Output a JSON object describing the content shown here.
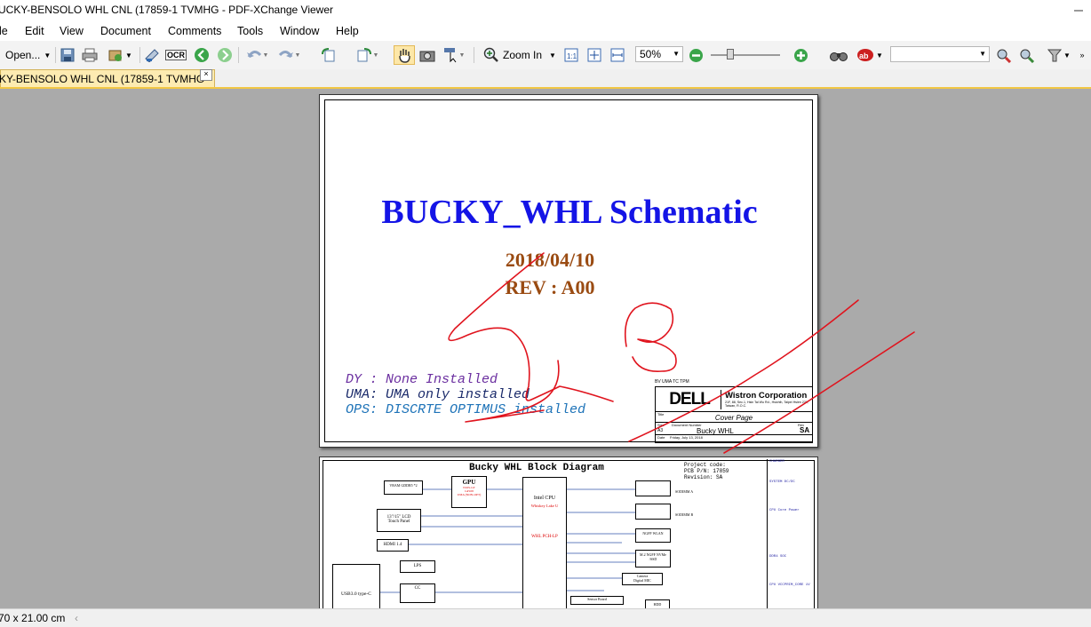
{
  "window": {
    "title": "UCKY-BENSOLO WHL CNL (17859-1 TVMHG - PDF-XChange Viewer"
  },
  "menu": [
    "le",
    "Edit",
    "View",
    "Document",
    "Comments",
    "Tools",
    "Window",
    "Help"
  ],
  "toolbar": {
    "open_label": "Open...",
    "ocr_label": "OCR",
    "zoom_in_label": "Zoom In",
    "zoom_value": "50%",
    "search_value": ""
  },
  "tab": {
    "label": "KY-BENSOLO WHL CNL (17859-1 TVMHG",
    "close": "×"
  },
  "cover_page": {
    "title": "BUCKY_WHL Schematic",
    "date": "2018/04/10",
    "rev": "REV : A00",
    "legend": [
      {
        "text": "DY : None Installed",
        "color": "#6b2fa0"
      },
      {
        "text": "UMA: UMA only installed",
        "color": "#1a2a6a"
      },
      {
        "text": "OPS: DISCRTE OPTIMUS installed",
        "color": "#1e73b8"
      }
    ],
    "titleblock": {
      "header_note": "BV UMA TC TPM",
      "logo": "DELL",
      "company": "Wistron Corporation",
      "address": "21F, 88, Sec.1, Hsin Tai Wu Rd., Hsichih, Taipei Hsien 221, Taiwan, R.O.C.",
      "title_label": "Title",
      "sheet_title": "Cover Page",
      "size_label": "Size",
      "size_value": "A3",
      "doc_label": "Document Number",
      "doc_value": "Bucky WHL",
      "rev_label": "Rev",
      "rev_value": "SA",
      "date_label": "Date",
      "date_value": "Friday, July 13, 2018"
    }
  },
  "block_page": {
    "title": "Bucky WHL Block Diagram",
    "project": "Project code:\nPCB P/N: 17859\nRevision: SA",
    "blocks": {
      "vram": "VRAM GDDR5 *2",
      "gpu": "GPU",
      "gpu_sub": "N16S-GT\nGP108\nUMA (NON-OPT)",
      "lcd": "13\"/15\" LCD\nTouch Panel",
      "hdmi": "HDMI 1.4",
      "cpu": "Intel CPU",
      "cpu_sub": "Whiskey Lake U",
      "pch": "WHL PCH-LP",
      "ddr1": "DDR4",
      "sodimm_a": "SODIMM A",
      "sodimm_b": "SODIMM B",
      "ngff_wlan": "NGFF WLAN",
      "m2": "M.2 NGFF NVMe\n/SSD",
      "camera": "Camera\nDigital MIC",
      "sensor": "Sensor Board",
      "lps": "LPS",
      "cc": "CC",
      "usb": "USB3.0 type-C",
      "hdd": "HDD"
    },
    "side_notes": [
      "CHARGER",
      "SYSTEM DC/DC",
      "CPU Core Power",
      "DDR4 SOC",
      "CPU VCCPRIM_CORE 1V"
    ]
  },
  "status": {
    "page_size": "70 x 21.00 cm"
  }
}
